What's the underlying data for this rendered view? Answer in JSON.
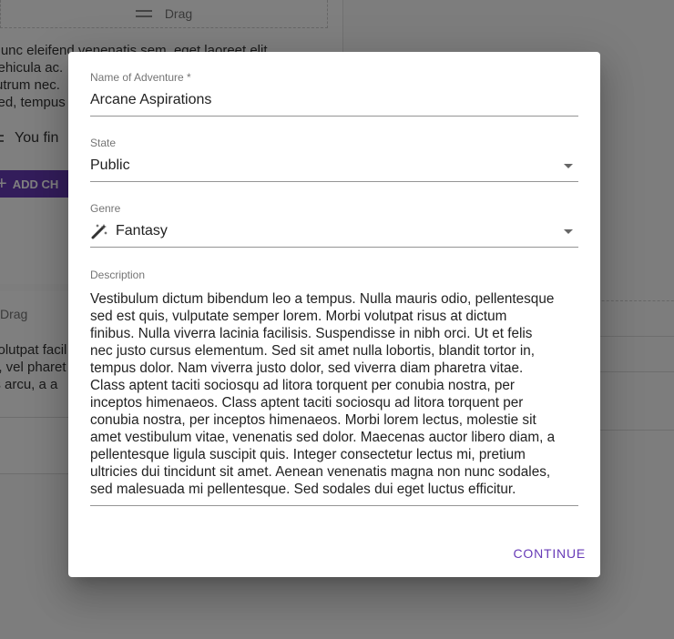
{
  "background": {
    "drag_label_top": "Drag",
    "text_lines_a": [
      "Nunc eleifend venenatis sem, eget laoreet elit",
      "vehicula ac.",
      "rutrum nec.",
      "sed, tempus"
    ],
    "you_row_text": "You fin",
    "add_button_label": "ADD CH",
    "drag_label_mid": "Drag",
    "text_lines_b": [
      "volutpat facil",
      "n, vel pharet",
      "is arcu, a a"
    ]
  },
  "dialog": {
    "name_field": {
      "label": "Name of Adventure *",
      "value": "Arcane Aspirations"
    },
    "state_field": {
      "label": "State",
      "value": "Public"
    },
    "genre_field": {
      "label": "Genre",
      "icon": "magic-wand-icon",
      "value": "Fantasy"
    },
    "description_field": {
      "label": "Description",
      "value": "Vestibulum dictum bibendum leo a tempus. Nulla mauris odio, pellentesque\nsed est quis, vulputate semper lorem. Morbi volutpat risus at dictum\nfinibus. Nulla viverra lacinia facilisis. Suspendisse in nibh orci. Ut et felis\nnec justo cursus elementum. Sed sit amet nulla lobortis, blandit tortor in,\ntempus dolor. Nam viverra justo dolor, sed viverra diam pharetra vitae.\nClass aptent taciti sociosqu ad litora torquent per conubia nostra, per\ninceptos himenaeos. Class aptent taciti sociosqu ad litora torquent per\nconubia nostra, per inceptos himenaeos. Morbi lorem lectus, molestie sit\namet vestibulum vitae, venenatis sed dolor. Maecenas auctor libero diam, a\npellentesque ligula suscipit quis. Integer consectetur lectus mi, pretium\nultricies dui tincidunt sit amet. Aenean venenatis magna non nunc sodales,\nsed malesuada mi pellentesque. Sed sodales dui eget luctus efficitur."
    },
    "continue_label": "CONTINUE"
  },
  "colors": {
    "accent": "#673ab7",
    "overlay": "rgba(0,0,0,0.5)"
  }
}
